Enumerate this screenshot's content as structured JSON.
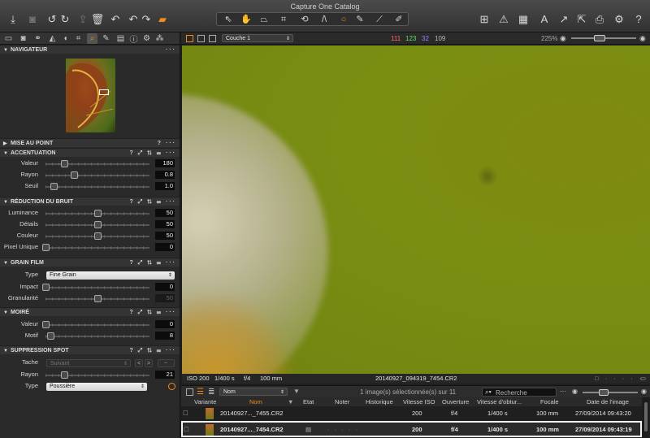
{
  "window": {
    "title": "Capture One Catalog"
  },
  "toolbar": {
    "icons_left": [
      "import-icon",
      "camera-icon",
      "rotate-left-icon",
      "rotate-right-icon",
      "export-icon",
      "trash-icon",
      "undo-icon",
      "undo-alt-icon",
      "redo-icon",
      "variants-icon"
    ],
    "tool_group": [
      "select-icon",
      "pan-icon",
      "keystone-icon",
      "crop-icon",
      "rotate-icon",
      "straighten-icon",
      "spot-removal-icon",
      "brush-icon",
      "gradient-icon",
      "pick-icon"
    ],
    "icons_right": [
      "grid-view-icon",
      "warning-icon",
      "grid-overlay-icon",
      "text-icon",
      "cursor-icon",
      "print-icon",
      "settings-icon",
      "help-icon"
    ]
  },
  "viewer_top": {
    "layer_label": "Couche 1",
    "rgb": {
      "r": "111",
      "g": "123",
      "b": "32",
      "l": "109"
    },
    "zoom": "225%"
  },
  "panels": {
    "navigator": {
      "title": "NAVIGATEUR"
    },
    "focus": {
      "title": "MISE AU POINT"
    },
    "sharpening": {
      "title": "ACCENTUATION",
      "rows": [
        {
          "label": "Valeur",
          "value": "180",
          "level": 0.18
        },
        {
          "label": "Rayon",
          "value": "0.8",
          "level": 0.27
        },
        {
          "label": "Seuil",
          "value": "1.0",
          "level": 0.08
        }
      ]
    },
    "noise": {
      "title": "RÉDUCTION DU BRUIT",
      "rows": [
        {
          "label": "Luminance",
          "value": "50",
          "level": 0.5
        },
        {
          "label": "Détails",
          "value": "50",
          "level": 0.5
        },
        {
          "label": "Couleur",
          "value": "50",
          "level": 0.5
        },
        {
          "label": "Pixel Unique",
          "value": "0",
          "level": 0.0
        }
      ]
    },
    "grain": {
      "title": "GRAIN FILM",
      "type_label": "Type",
      "type_value": "Fine Grain",
      "rows": [
        {
          "label": "Impact",
          "value": "0",
          "level": 0.0
        },
        {
          "label": "Granularité",
          "value": "50",
          "level": 0.5
        }
      ]
    },
    "moire": {
      "title": "MOIRÉ",
      "rows": [
        {
          "label": "Valeur",
          "value": "0",
          "level": 0.0
        },
        {
          "label": "Motif",
          "value": "8",
          "level": 0.05
        }
      ]
    },
    "spot": {
      "title": "SUPPRESSION SPOT",
      "tache_label": "Tache",
      "tache_value": "Suivant",
      "rayon_label": "Rayon",
      "rayon_value": "21",
      "rayon_level": 0.18,
      "type_label": "Type",
      "type_value": "Poussière"
    }
  },
  "viewer_info": {
    "iso": "ISO 200",
    "shutter": "1/400 s",
    "aperture": "f/4",
    "focal": "100 mm",
    "filename": "20140927_094319_7454.CR2"
  },
  "browser": {
    "sort_label": "Nom",
    "selection_text": "1 image(s) sélectionnée(s) sur 11",
    "search_placeholder": "Recherche",
    "columns": [
      "Variante",
      "Nom",
      "Etat",
      "Noter",
      "Historique",
      "Vitesse ISO",
      "Ouverture",
      "Vitesse d'obtur...",
      "Focale",
      "Date de l'image"
    ],
    "rows": [
      {
        "name": "20140927..._7455.CR2",
        "iso": "200",
        "aperture": "f/4",
        "shutter": "1/400 s",
        "focal": "100 mm",
        "date": "27/09/2014 09:43:20"
      },
      {
        "name": "20140927..._7454.CR2",
        "iso": "200",
        "aperture": "f/4",
        "shutter": "1/400 s",
        "focal": "100 mm",
        "date": "27/09/2014 09:43:19"
      }
    ]
  }
}
